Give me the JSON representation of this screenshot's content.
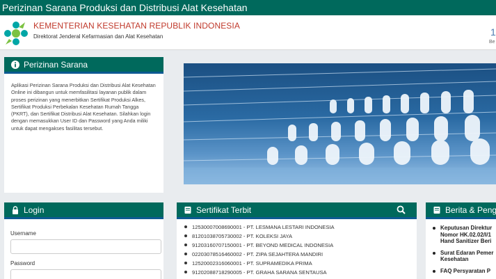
{
  "topbar": {
    "title": "Perizinan Sarana Produksi dan Distribusi Alat Kesehatan"
  },
  "header": {
    "ministry": "KEMENTERIAN KESEHATAN REPUBLIK INDONESIA",
    "directorate": "Direktorat Jenderal Kefarmasian dan Alat Kesehatan",
    "corner_number": "1",
    "corner_text": "Be"
  },
  "intro": {
    "title": "Perizinan Sarana",
    "icon": "info-icon",
    "text": "Aplikasi Perizinan Sarana Produksi dan Distribusi Alat Kesehatan Online ini dibangun untuk memfasilitasi layanan publik dalam proses perizinan yang menerbitkan Sertifikat Produksi Alkes, Sertifikat Produksi Perbekalan Kesehatan Rumah Tangga (PKRT), dan Sertifikat Distribusi Alat Kesehatan. Silahkan login dengan memasukkan User ID dan Password yang Anda miliki untuk dapat mengakses fasilitas tersebut."
  },
  "login": {
    "title": "Login",
    "icon": "lock-icon",
    "username_label": "Username",
    "password_label": "Password"
  },
  "certificates": {
    "title": "Sertifikat Terbit",
    "icon": "book-icon",
    "search_icon": "search-icon",
    "items": [
      {
        "number": "12530007008690001",
        "company": "PT. LESMANA LESTARI INDONESIA"
      },
      {
        "number": "81201038705730002",
        "company": "PT. KOLEKSI JAYA"
      },
      {
        "number": "91203160707150001",
        "company": "PT. BEYOND MEDICAL INDONESIA"
      },
      {
        "number": "02203078516460002",
        "company": "PT. ZIPA SEJAHTERA MANDIRI"
      },
      {
        "number": "12520002316060001",
        "company": "PT. SUPRAMEDIKA PRIMA"
      },
      {
        "number": "91202088718290005",
        "company": "PT. GRAHA SARANA SENTAUSA"
      }
    ]
  },
  "news": {
    "title": "Berita & Pengu",
    "icon": "book-icon",
    "items": [
      {
        "lines": [
          "Keputusan Direktur",
          "Nomor HK.02.02/I/1",
          "Hand Sanitizer Beri"
        ]
      },
      {
        "lines": [
          "Surat Edaran Pemer",
          "Kesehatan"
        ]
      },
      {
        "lines": [
          "FAQ Persyaratan P"
        ]
      }
    ]
  },
  "colors": {
    "header_green": "#00695c",
    "accent_blue": "#0d5a91",
    "ministry_red": "#c0392b"
  }
}
